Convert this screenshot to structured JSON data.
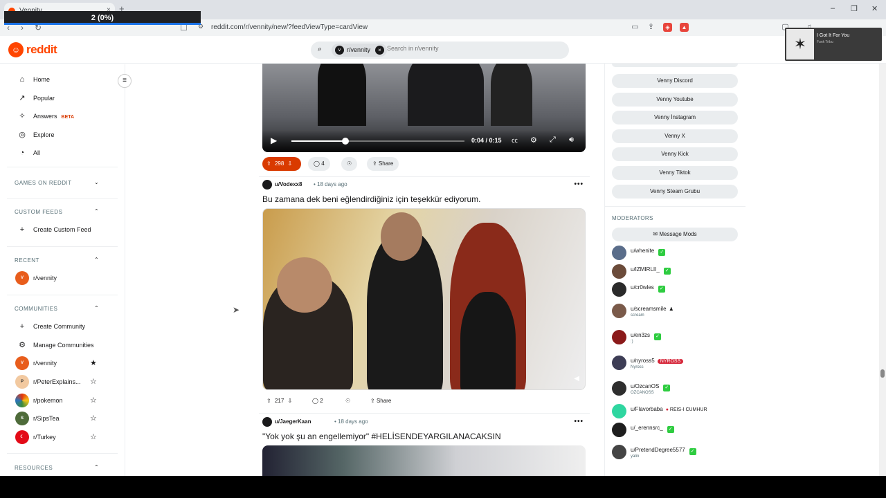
{
  "browser": {
    "tab_title": "Vennity",
    "tab_close": "×",
    "new_tab": "+",
    "counter": "2 (0%)",
    "url": "reddit.com/r/vennity/new/?feedViewType=cardView",
    "window_min": "–",
    "window_max": "❐",
    "window_close": "✕"
  },
  "media_popup": {
    "title": "I Got It For You",
    "artist": "Funk Tribu"
  },
  "header": {
    "logo_text": "reddit",
    "search_scope": "r/vennity",
    "search_placeholder": "Search in r/vennity"
  },
  "sidebar": {
    "nav": [
      {
        "label": "Home",
        "icon": "home-icon"
      },
      {
        "label": "Popular",
        "icon": "popular-icon"
      },
      {
        "label": "Answers",
        "badge": "BETA",
        "icon": "answers-icon"
      },
      {
        "label": "Explore",
        "icon": "explore-icon"
      },
      {
        "label": "All",
        "icon": "all-icon"
      }
    ],
    "games_header": "GAMES ON REDDIT",
    "custom_feeds_header": "CUSTOM FEEDS",
    "create_custom_feed": "Create Custom Feed",
    "recent_header": "RECENT",
    "recent": [
      {
        "label": "r/vennity"
      }
    ],
    "communities_header": "COMMUNITIES",
    "create_community": "Create Community",
    "manage_communities": "Manage Communities",
    "communities": [
      {
        "label": "r/vennity",
        "starred": true,
        "color": "#e85d1c"
      },
      {
        "label": "r/PeterExplains...",
        "starred": false,
        "color": "#f2c9a0"
      },
      {
        "label": "r/pokemon",
        "starred": false,
        "color": "#f5c518"
      },
      {
        "label": "r/SipsTea",
        "starred": false,
        "color": "#4e6b3a"
      },
      {
        "label": "r/Turkey",
        "starred": false,
        "color": "#e30a17"
      }
    ],
    "resources_header": "RESOURCES"
  },
  "feed": {
    "video": {
      "time": "0:04 / 0:15",
      "progress": 0.31
    },
    "post1_actions": {
      "votes": "298",
      "comments": "4",
      "share": "Share"
    },
    "post2": {
      "author": "u/Vodexx8",
      "age": "• 18 days ago",
      "title": "Bu zamana dek beni eğlendirdiğiniz için teşekkür ediyorum.",
      "votes": "217",
      "comments": "2",
      "share": "Share"
    },
    "post3": {
      "author": "u/JaegerKaan",
      "age": "• 18 days ago",
      "title": "\"Yok yok şu an engellemiyor\" #HELİSENDEYARGILANACAKSIN"
    }
  },
  "right_sidebar": {
    "links": [
      "Venny Discord",
      "Venny Youtube",
      "Venny İnstagram",
      "Venny X",
      "Venny Kick",
      "Venny Tiktok",
      "Venny Steam Grubu"
    ],
    "moderators_header": "MODERATORS",
    "message_mods": "Message Mods",
    "moderators": [
      {
        "name": "u/whenite",
        "flair": "",
        "check": true,
        "color": "#5a6d8a"
      },
      {
        "name": "u/IZMIRLII_",
        "flair": "",
        "check": true,
        "color": "#6b4b3a"
      },
      {
        "name": "u/cr0wles",
        "flair": "",
        "check": true,
        "color": "#2b2b2b"
      },
      {
        "name": "u/screamsmile",
        "flair": "scream",
        "check": false,
        "color": "#7a5a4a"
      },
      {
        "name": "u/en3zs",
        "flair": ":)",
        "check": true,
        "color": "#8b1a1a"
      },
      {
        "name": "u/nyross5",
        "flair": "Nyross",
        "check": false,
        "badge": "NYROSS",
        "color": "#3d3d55"
      },
      {
        "name": "u/OzcanOS",
        "flair": "OZCANOSS",
        "check": true,
        "color": "#2e2e2e"
      },
      {
        "name": "u/Flavorbaba",
        "flair": "",
        "check": false,
        "badge_plain": "REIS-I CUMHUR",
        "color": "#2fd6a0"
      },
      {
        "name": "u/_erennsrc_",
        "flair": "",
        "check": true,
        "color": "#1e1e1e"
      },
      {
        "name": "u/PretendDegree5577",
        "flair": "yalin",
        "check": true,
        "color": "#444"
      }
    ]
  }
}
